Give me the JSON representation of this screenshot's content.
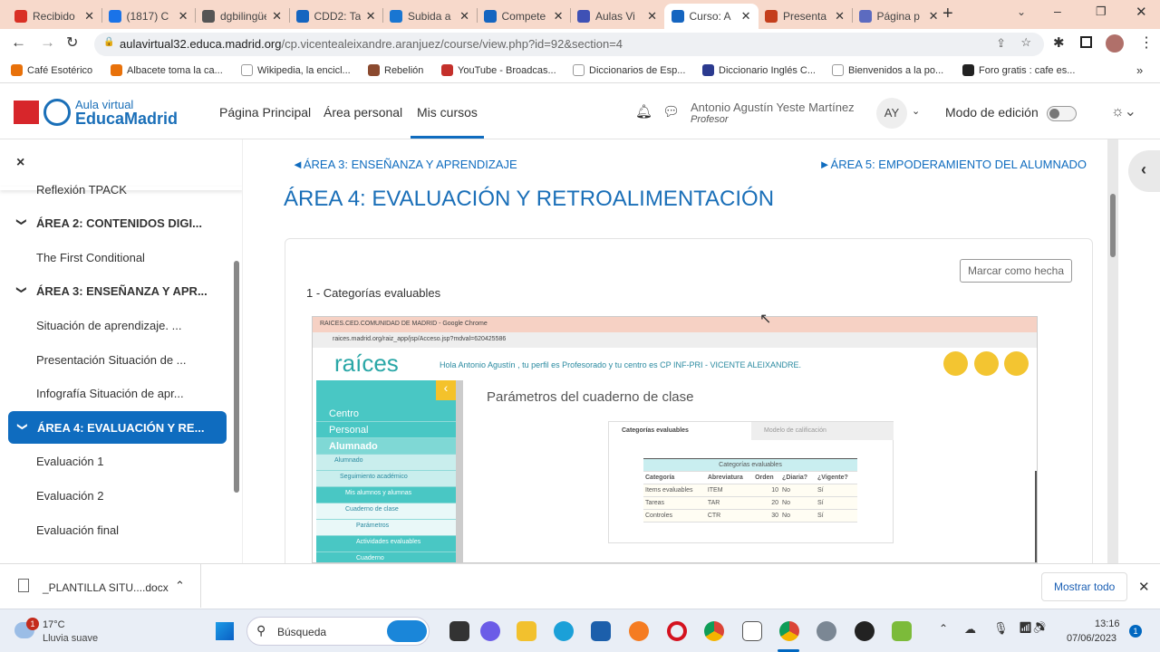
{
  "browser": {
    "tabs": [
      {
        "label": "Recibido",
        "color": "#d93025"
      },
      {
        "label": "(1817) C",
        "color": "#1a73e8"
      },
      {
        "label": "dgbilingüe",
        "color": "#555"
      },
      {
        "label": "CDD2: Ta",
        "color": "#1565c0"
      },
      {
        "label": "Subida a",
        "color": "#1976d2"
      },
      {
        "label": "Compete",
        "color": "#1565c0"
      },
      {
        "label": "Aulas Vi",
        "color": "#3f51b5"
      },
      {
        "label": "Curso: A",
        "color": "#1565c0",
        "active": true
      },
      {
        "label": "Presenta",
        "color": "#c43e1c"
      },
      {
        "label": "Página p",
        "color": "#5c6bc0"
      }
    ],
    "url_host": "aulavirtual32.educa.madrid.org",
    "url_path": "/cp.vicentealeixandre.aranjuez/course/view.php?id=92&section=4",
    "bookmarks": [
      "Café Esotérico",
      "Albacete toma la ca...",
      "Wikipedia, la encicl...",
      "Rebelión",
      "YouTube - Broadcas...",
      "Diccionarios de Esp...",
      "Diccionario Inglés C...",
      "Bienvenidos a la po...",
      "Foro gratis : cafe es..."
    ]
  },
  "header": {
    "logo_line1": "Aula virtual",
    "logo_line2": "EducaMadrid",
    "nav": [
      "Página Principal",
      "Área personal",
      "Mis cursos"
    ],
    "user_name": "Antonio Agustín Yeste Martínez",
    "user_role": "Profesor",
    "avatar": "AY",
    "edit_mode": "Modo de edición"
  },
  "sidebar": {
    "close": "×",
    "items": [
      {
        "label": "Reflexión TPACK",
        "type": "activity"
      },
      {
        "label": "ÁREA 2: CONTENIDOS DIGI...",
        "type": "section"
      },
      {
        "label": "The First Conditional",
        "type": "activity"
      },
      {
        "label": "ÁREA 3: ENSEÑANZA Y APR...",
        "type": "section"
      },
      {
        "label": "Situación de aprendizaje. ...",
        "type": "activity"
      },
      {
        "label": "Presentación Situación de ...",
        "type": "activity"
      },
      {
        "label": "Infografía Situación de apr...",
        "type": "activity"
      },
      {
        "label": "ÁREA 4: EVALUACIÓN Y RE...",
        "type": "section",
        "active": true
      },
      {
        "label": "Evaluación 1",
        "type": "activity"
      },
      {
        "label": "Evaluación 2",
        "type": "activity"
      },
      {
        "label": "Evaluación final",
        "type": "activity"
      }
    ]
  },
  "main": {
    "prev": "◄ÁREA 3: ENSEÑANZA Y APRENDIZAJE",
    "next": "►ÁREA 5: EMPODERAMIENTO DEL ALUMNADO",
    "title": "ÁREA 4: EVALUACIÓN Y RETROALIMENTACIÓN",
    "mark_done": "Marcar como hecha",
    "activity": "1 - Categorías evaluables"
  },
  "embed": {
    "window_title": "RAICES.CED.COMUNIDAD DE MADRID - Google Chrome",
    "url": "raices.madrid.org/raiz_app/jsp/Acceso.jsp?mdval=620425586",
    "logo": "raíces",
    "greeting": "Hola Antonio Agustín , tu perfil es Profesorado y tu centro es CP INF-PRI - VICENTE ALEIXANDRE.",
    "menu": [
      "Centro",
      "Personal",
      "Alumnado",
      "Alumnado",
      "Seguimiento académico",
      "Mis alumnos y alumnas",
      "Cuaderno de clase",
      "Parámetros",
      "Actividades evaluables",
      "Cuaderno"
    ],
    "page_title": "Parámetros del cuaderno de clase",
    "tabs": [
      "Categorías evaluables",
      "Modelo de calificación"
    ],
    "table_caption": "Categorías evaluables",
    "columns": [
      "Categoría",
      "Abreviatura",
      "Orden",
      "¿Diaria?",
      "¿Vigente?"
    ],
    "rows": [
      [
        "Items evaluables",
        "ITEM",
        "10",
        "No",
        "Sí"
      ],
      [
        "Tareas",
        "TAR",
        "20",
        "No",
        "Sí"
      ],
      [
        "Controles",
        "CTR",
        "30",
        "No",
        "Sí"
      ]
    ]
  },
  "download": {
    "file": "_PLANTILLA SITU....docx",
    "show_all": "Mostrar todo"
  },
  "taskbar": {
    "temp": "17°C",
    "weather": "Lluvia suave",
    "weather_badge": "1",
    "search": "Búsqueda",
    "time": "13:16",
    "date": "07/06/2023",
    "notif": "1"
  }
}
